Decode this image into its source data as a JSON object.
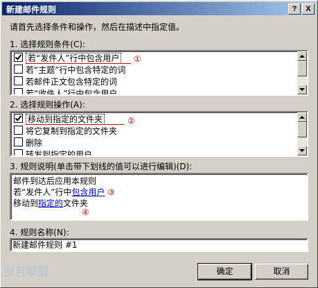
{
  "window": {
    "title": "新建邮件规则",
    "help_label": "?",
    "close_label": "X"
  },
  "instruction": "请首先选择条件和操作，然后在描述中指定值。",
  "conditions": {
    "label": "1. 选择规则条件(C):",
    "items": [
      {
        "label": "若“发件人”行中包含用户",
        "checked": true
      },
      {
        "label": "若“主题”行中包含特定的词",
        "checked": false
      },
      {
        "label": "若邮件正文包含特定的词",
        "checked": false
      },
      {
        "label": "若“收件人”行中包含用户",
        "checked": false
      }
    ],
    "marker": "①"
  },
  "actions": {
    "label": "2. 选择规则操作(A):",
    "items": [
      {
        "label": "移动到指定的文件夹",
        "checked": true
      },
      {
        "label": "将它复制到指定的文件夹",
        "checked": false
      },
      {
        "label": "删除",
        "checked": false
      },
      {
        "label": "转发到指定的用户",
        "checked": false
      }
    ],
    "marker": "②"
  },
  "description": {
    "label": "3. 规则说明(单击带下划线的值可以进行编辑)(D):",
    "line1": "邮件到达后应用本规则",
    "line2_prefix": "若“发件人”行中",
    "line2_link": "包含用户",
    "line2_marker": "③",
    "line3_prefix": "移动到",
    "line3_link": "指定的",
    "line3_suffix": "文件夹",
    "line3_marker": "④"
  },
  "rule_name": {
    "label": "4. 规则名称(N):",
    "value": "新建邮件规则 #1"
  },
  "buttons": {
    "ok": "确定",
    "cancel": "取消"
  },
  "watermark": "岁月联盟",
  "colors": {
    "title_start": "#0a246a",
    "title_end": "#a6caf0",
    "dialog_bg": "#d4d0c8",
    "link": "#0000cc",
    "marker": "#d00000"
  }
}
